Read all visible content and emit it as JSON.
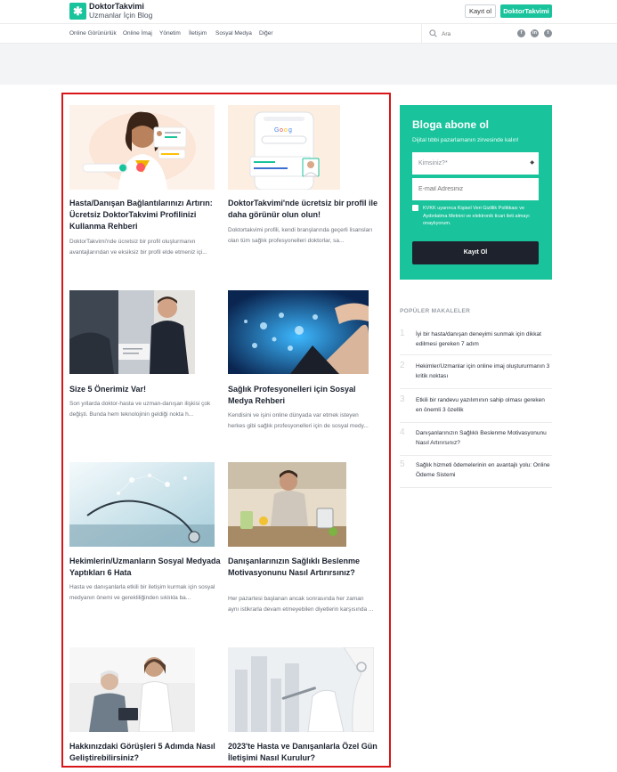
{
  "header": {
    "brand": "DoktorTakvimi",
    "subtitle": "Uzmanlar İçin Blog",
    "logo_icon": "asterisk-icon",
    "register_label": "Kayıt ol",
    "brand_button_label": "DoktorTakvimi"
  },
  "nav": {
    "items": [
      "Online Görünürlük",
      "Online İmaj",
      "Yönetim",
      "İletişim",
      "Sosyal Medya",
      "Diğer"
    ],
    "search_placeholder": "Ara",
    "social": [
      "facebook-icon",
      "linkedin-icon",
      "twitter-icon"
    ]
  },
  "articles": [
    {
      "title": "Hasta/Danışan Bağlantılarınızı Artırın: Ücretsiz DoktorTakvimi Profilinizi Kullanma Rehberi",
      "excerpt": "DoktorTakvimi'nde ücretsiz bir profil oluşturmanın avantajlarından ve eksiksiz bir profil elde etmeniz içi..."
    },
    {
      "title": "DoktorTakvimi'nde ücretsiz bir profil ile daha görünür olun olun!",
      "excerpt": "Doktortakvimi profili, kendi branşlarında geçerli lisansları olan tüm sağlık profesyonelleri doktorlar, sa..."
    },
    {
      "title": "Size 5 Önerimiz Var!",
      "excerpt": "Son yıllarda doktor-hasta ve uzman-danışan ilişkisi çok değişti. Bunda hem teknolojinin geldiği nokta h..."
    },
    {
      "title": "Sağlık Profesyonelleri için Sosyal Medya Rehberi",
      "excerpt": "Kendisini ve işini online dünyada var etmek isteyen herkes gibi sağlık profesyonelleri için de sosyal medy..."
    },
    {
      "title": "Hekimlerin/Uzmanların Sosyal Medyada Yaptıkları 6 Hata",
      "excerpt": "Hasta ve danışanlarla etkili bir iletişim kurmak için sosyal medyanın önemi ve gerekliliğinden sıklıkla ba..."
    },
    {
      "title": "Danışanlarınızın Sağlıklı Beslenme Motivasyonunu Nasıl Artırırsınız?",
      "excerpt": "Her pazartesi başlanan ancak sonrasında her zaman aynı istikrarla devam etmeyebilen diyetlerin karşısında ..."
    },
    {
      "title": "Hakkınızdaki Görüşleri 5 Adımda Nasıl Geliştirebilirsiniz?",
      "excerpt": ""
    },
    {
      "title": "2023'te Hasta ve Danışanlarla Özel Gün İletişimi Nasıl Kurulur?",
      "excerpt": ""
    }
  ],
  "subscribe": {
    "title": "Bloga abone ol",
    "text": "Dijital tıbbi pazarlamanın zirvesinde kalın!",
    "select_placeholder": "Kimsiniz?*",
    "email_placeholder": "E-mail Adresiniz",
    "consent": "KVKK uyarınca Kişisel Veri Gizlilik Politikası ve Aydınlatma Metnini ve elektronik ticari ileti almayı onaylıyorum.",
    "button": "Kayıt Ol"
  },
  "popular": {
    "heading": "POPÜLER MAKALELER",
    "items": [
      {
        "num": "1",
        "text": "İyi bir hasta/danışan deneyimi sunmak için dikkat edilmesi gereken 7 adım"
      },
      {
        "num": "2",
        "text": "Hekimler/Uzmanlar için online imaj oluştururmanın 3 kritik noktası"
      },
      {
        "num": "3",
        "text": "Etkili bir randevu yazılımının sahip olması gereken en önemli 3 özellik"
      },
      {
        "num": "4",
        "text": "Danışanlarınızın Sağlıklı Beslenme Motivasyonunu Nasıl Artırırsınız?"
      },
      {
        "num": "5",
        "text": "Sağlık hizmeti ödemelerinin en avantajlı yolu: Online Ödeme Sistemi"
      }
    ]
  },
  "colors": {
    "brand": "#19c39c",
    "highlight": "#d8161a",
    "dark_button": "#1e222c"
  }
}
